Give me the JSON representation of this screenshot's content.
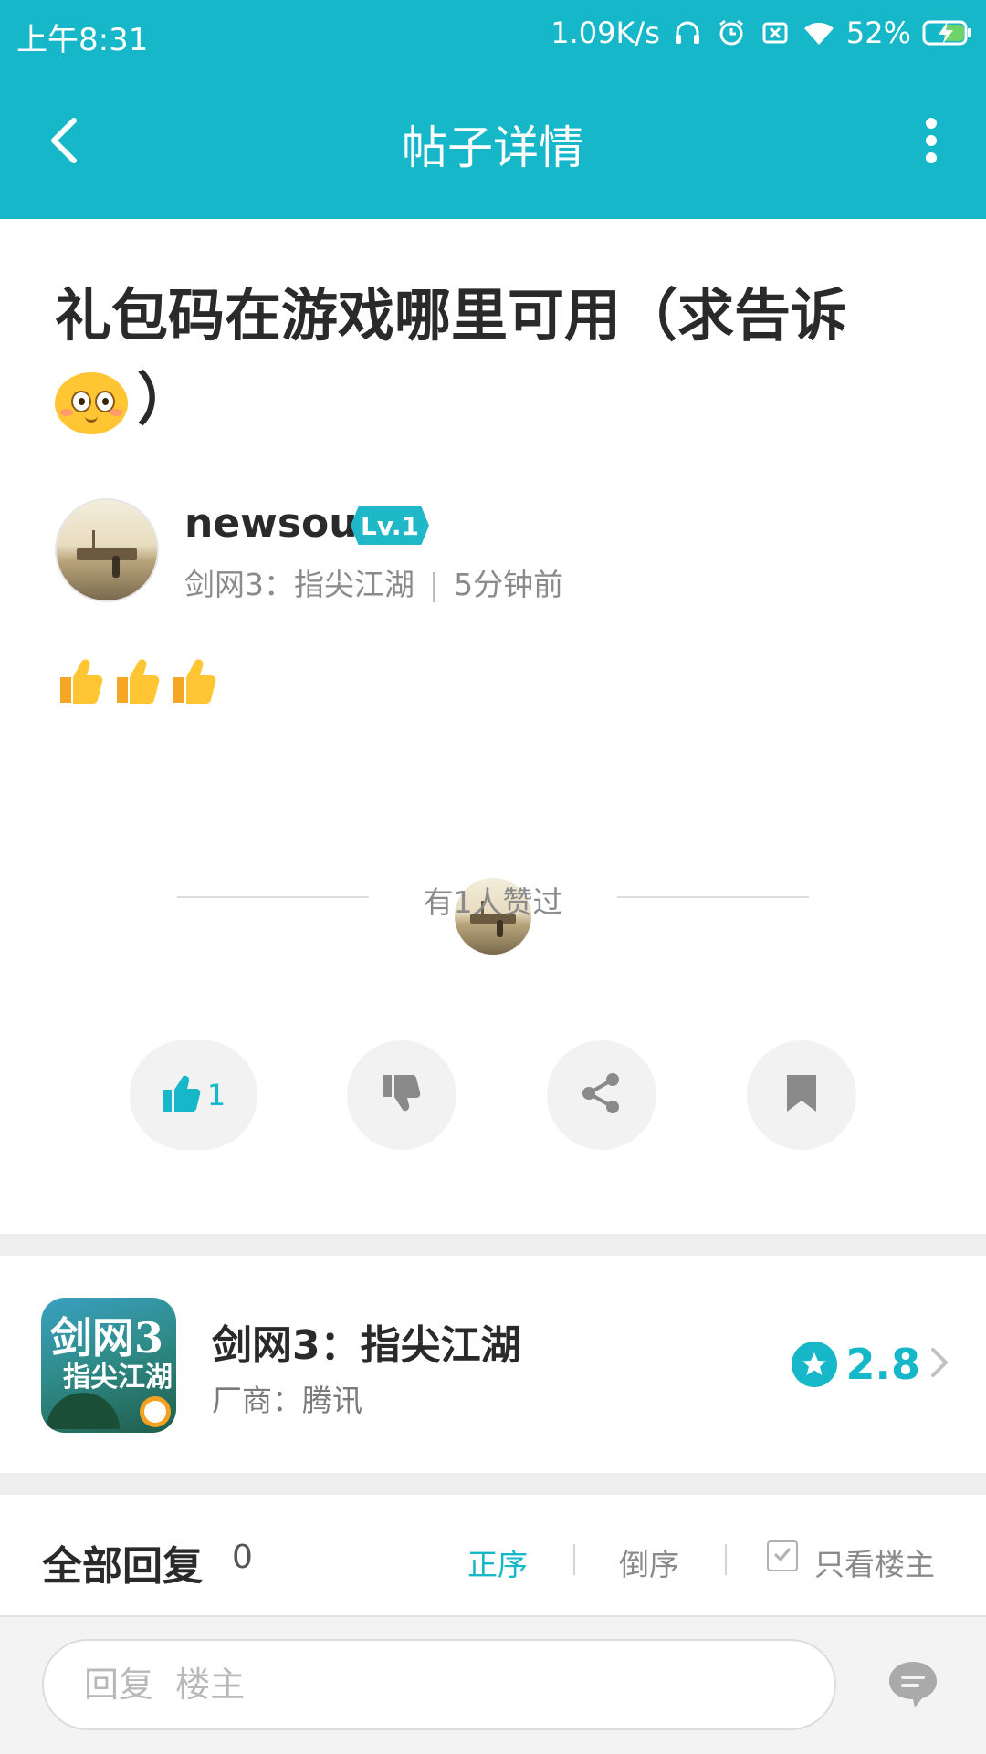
{
  "status_bar": {
    "time": "上午8:31",
    "net_speed": "1.09K/s",
    "battery": "52%",
    "icons": [
      "headphones-icon",
      "alarm-icon",
      "sim-off-icon",
      "wifi-icon",
      "battery-charging-icon"
    ]
  },
  "nav": {
    "title": "帖子详情",
    "back_icon": "chevron-left-icon",
    "more_icon": "more-vertical-icon"
  },
  "post": {
    "title": "礼包码在游戏哪里可用（求告诉",
    "title_tail": "）",
    "author": {
      "name": "newsoul",
      "level": "Lv.1"
    },
    "game": "剑网3：指尖江湖",
    "time_ago": "5分钟前",
    "body_emojis": [
      "thumbs-up",
      "thumbs-up",
      "thumbs-up"
    ],
    "liked_text": "有1人赞过"
  },
  "actions": {
    "like_count": "1",
    "icons": [
      "thumbs-up-icon",
      "thumbs-down-icon",
      "share-icon",
      "bookmark-icon"
    ]
  },
  "game_card": {
    "icon_text_line1": "剑网3",
    "icon_text_line2": "指尖江湖",
    "name": "剑网3：指尖江湖",
    "vendor": "厂商：腾讯",
    "rating": "2.8"
  },
  "replies": {
    "title": "全部回复",
    "count": "0",
    "sort_asc": "正序",
    "sort_desc": "倒序",
    "only_op": "只看楼主"
  },
  "reply_bar": {
    "placeholder": "回复  楼主"
  },
  "colors": {
    "accent": "#16b7c8",
    "text": "#2a2a2a",
    "muted": "#8a8a8a"
  }
}
